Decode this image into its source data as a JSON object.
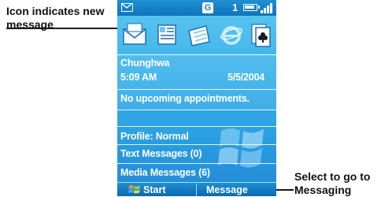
{
  "callouts": {
    "left": "Icon indicates new message",
    "right": "Select to go to Messaging"
  },
  "status": {
    "new_message_icon": "envelope-icon",
    "network_badge": "G",
    "line_number": "1",
    "battery_icon": "battery-icon",
    "signal_icon": "signal-icon"
  },
  "apps": [
    {
      "icon": "messaging-envelope-icon"
    },
    {
      "icon": "contacts-card-icon"
    },
    {
      "icon": "calendar-icon"
    },
    {
      "icon": "internet-explorer-icon"
    },
    {
      "icon": "solitaire-cards-icon"
    }
  ],
  "home": {
    "operator": "Chunghwa",
    "time": "5:09 AM",
    "date": "5/5/2004",
    "appointments": "No upcoming appointments.",
    "profile": "Profile: Normal",
    "text_messages": "Text Messages (0)",
    "media_messages": "Media Messages (6)"
  },
  "softkeys": {
    "left": "Start",
    "right": "Message"
  },
  "colors": {
    "screen_top": "#5ec7f0",
    "screen_bottom": "#2288d6",
    "bar": "#0f74bd"
  }
}
